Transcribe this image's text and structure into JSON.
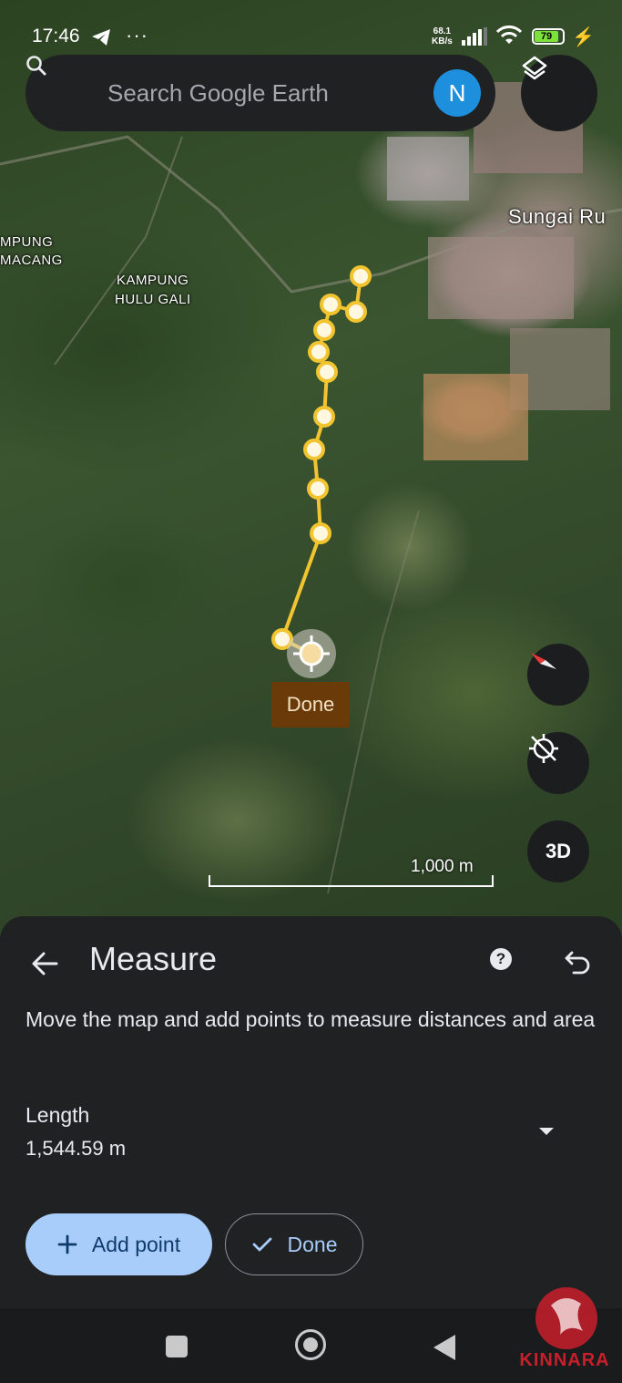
{
  "status_bar": {
    "time": "17:46",
    "net_speed_value": "68.1",
    "net_speed_unit": "KB/s",
    "battery": "79"
  },
  "search": {
    "placeholder": "Search Google Earth",
    "avatar_initial": "N"
  },
  "map": {
    "labels": {
      "sungai": "Sungai Ru",
      "kampung_macang_1": "MPUNG",
      "kampung_macang_2": "MACANG",
      "kampung_hulu_1": "KAMPUNG",
      "kampung_hulu_2": "HULU GALI"
    },
    "done_tag": "Done",
    "scale_label": "1,000 m",
    "three_d_label": "3D",
    "path_color": "#f2c530"
  },
  "panel": {
    "title": "Measure",
    "description": "Move the map and add points to measure distances and area",
    "length_label": "Length",
    "length_value": "1,544.59 m",
    "add_point_label": "Add point",
    "done_label": "Done"
  },
  "watermark": {
    "text": "KINNARA"
  }
}
